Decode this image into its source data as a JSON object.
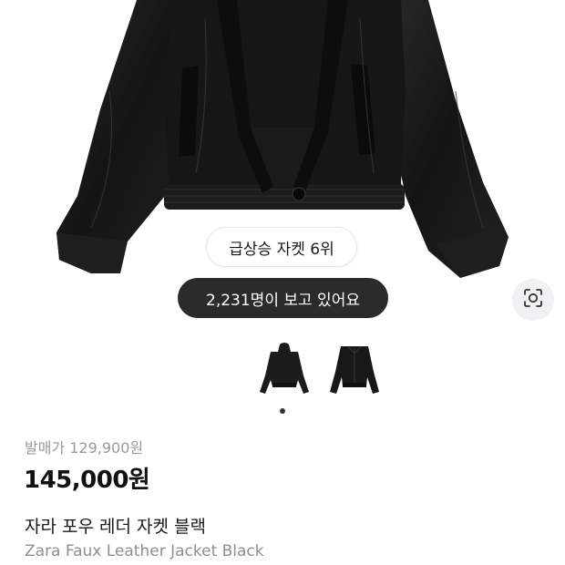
{
  "product": {
    "rank_badge": "급상승 자켓 6위",
    "viewers_badge": "2,231명이 보고 있어요",
    "original_price": "발매가 129,900원",
    "price": "145,000원",
    "name_ko": "자라 포우 레더 자켓 블랙",
    "name_en": "Zara Faux Leather Jacket Black"
  },
  "gallery": {
    "thumbnail_count": 2,
    "active_index": 1
  },
  "icons": {
    "lens": "visual-search-icon"
  },
  "colors": {
    "pill_dark": "#2b2b2b",
    "leather": "#151515",
    "muted_text": "#9a9a9a"
  }
}
